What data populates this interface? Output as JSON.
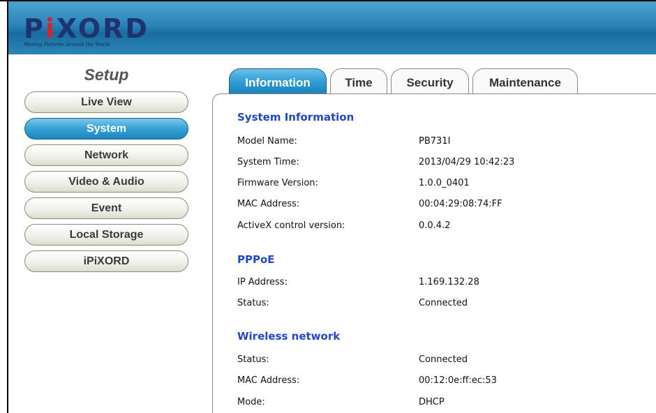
{
  "brand": {
    "logo_pre": "P",
    "logo_i": "i",
    "logo_post": "XORD",
    "tagline": "Moving Pictures Around the World"
  },
  "sidebar": {
    "title": "Setup",
    "items": [
      {
        "label": "Live View"
      },
      {
        "label": "System"
      },
      {
        "label": "Network"
      },
      {
        "label": "Video & Audio"
      },
      {
        "label": "Event"
      },
      {
        "label": "Local Storage"
      },
      {
        "label": "iPiXORD"
      }
    ],
    "active": "System"
  },
  "tabs": [
    {
      "label": "Information"
    },
    {
      "label": "Time"
    },
    {
      "label": "Security"
    },
    {
      "label": "Maintenance"
    }
  ],
  "sections": {
    "system_info": {
      "title": "System Information",
      "rows": [
        {
          "label": "Model Name:",
          "value": "PB731I"
        },
        {
          "label": "System Time:",
          "value": "2013/04/29 10:42:23"
        },
        {
          "label": "Firmware Version:",
          "value": "1.0.0_0401"
        },
        {
          "label": "MAC Address:",
          "value": "00:04:29:08:74:FF"
        },
        {
          "label": "ActiveX control version:",
          "value": "0.0.4.2"
        }
      ]
    },
    "pppoe": {
      "title": "PPPoE",
      "rows": [
        {
          "label": "IP Address:",
          "value": "1.169.132.28"
        },
        {
          "label": "Status:",
          "value": "Connected"
        }
      ]
    },
    "wireless": {
      "title": "Wireless network",
      "rows": [
        {
          "label": "Status:",
          "value": "Connected"
        },
        {
          "label": "MAC Address:",
          "value": "00:12:0e:ff:ec:53"
        },
        {
          "label": "Mode:",
          "value": "DHCP"
        }
      ]
    }
  },
  "colors": {
    "header_blue": "#2a84b8",
    "active_blue": "#2e9ad2",
    "section_title": "#2147c8",
    "logo_navy": "#1f3370",
    "logo_red": "#d8232a"
  }
}
